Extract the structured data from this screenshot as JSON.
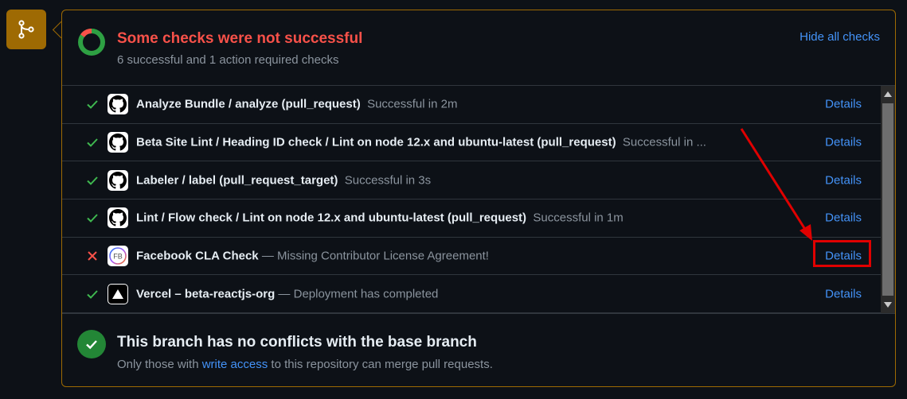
{
  "header": {
    "title": "Some checks were not successful",
    "subtitle": "6 successful and 1 action required checks",
    "hide_link": "Hide all checks"
  },
  "checks": [
    {
      "status": "success",
      "icon": "github-icon",
      "name": "Analyze Bundle / analyze (pull_request)",
      "desc": "Successful in 2m",
      "sep": "  ",
      "details": "Details"
    },
    {
      "status": "success",
      "icon": "github-icon",
      "name": "Beta Site Lint / Heading ID check / Lint on node 12.x and ubuntu-latest (pull_request)",
      "desc": "Successful in ...",
      "sep": "  ",
      "details": "Details"
    },
    {
      "status": "success",
      "icon": "github-icon",
      "name": "Labeler / label (pull_request_target)",
      "desc": "Successful in 3s",
      "sep": "  ",
      "details": "Details"
    },
    {
      "status": "success",
      "icon": "github-icon",
      "name": "Lint / Flow check / Lint on node 12.x and ubuntu-latest (pull_request)",
      "desc": "Successful in 1m",
      "sep": "  ",
      "details": "Details"
    },
    {
      "status": "failure",
      "icon": "facebook-cla-icon",
      "name": "Facebook CLA Check",
      "desc": "Missing Contributor License Agreement!",
      "sep": " — ",
      "details": "Details"
    },
    {
      "status": "success",
      "icon": "vercel-icon",
      "name": "Vercel – beta-reactjs-org",
      "desc": "Deployment has completed",
      "sep": " — ",
      "details": "Details"
    }
  ],
  "merge": {
    "title": "This branch has no conflicts with the base branch",
    "sub_before": "Only those with ",
    "sub_link": "write access",
    "sub_after": " to this repository can merge pull requests."
  },
  "icons": {
    "fb_cla_text": "FB"
  },
  "colors": {
    "fail": "#f85149",
    "success": "#3fb950",
    "link": "#4493f8",
    "badge": "#9e6a03",
    "annotation": "#e00000"
  }
}
